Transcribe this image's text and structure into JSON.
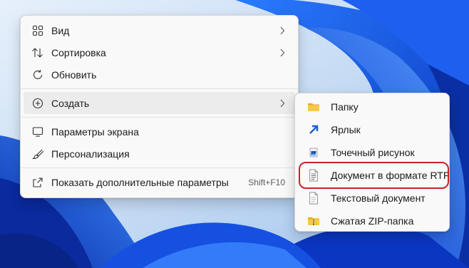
{
  "context_menu": {
    "items": [
      {
        "label": "Вид",
        "icon": "grid-icon",
        "has_submenu": true
      },
      {
        "label": "Сортировка",
        "icon": "sort-icon",
        "has_submenu": true
      },
      {
        "label": "Обновить",
        "icon": "refresh-icon",
        "has_submenu": false
      },
      {
        "label": "Создать",
        "icon": "plus-circle-icon",
        "has_submenu": true,
        "hovered": true
      },
      {
        "label": "Параметры экрана",
        "icon": "display-icon",
        "has_submenu": false
      },
      {
        "label": "Персонализация",
        "icon": "brush-icon",
        "has_submenu": false
      },
      {
        "label": "Показать дополнительные параметры",
        "icon": "open-external-icon",
        "shortcut": "Shift+F10"
      }
    ]
  },
  "create_submenu": {
    "items": [
      {
        "label": "Папку",
        "icon": "folder-icon"
      },
      {
        "label": "Ярлык",
        "icon": "shortcut-arrow-icon"
      },
      {
        "label": "Точечный рисунок",
        "icon": "bitmap-icon"
      },
      {
        "label": "Документ в формате RTF",
        "icon": "rtf-document-icon",
        "highlighted": true
      },
      {
        "label": "Текстовый документ",
        "icon": "text-document-icon"
      },
      {
        "label": "Сжатая ZIP-папка",
        "icon": "zip-folder-icon"
      }
    ]
  },
  "colors": {
    "menu_background": "#f9f9f9",
    "hover_background": "#ececec",
    "highlight_ring": "#c8232c",
    "wallpaper_blue": "#0a4fd8"
  }
}
